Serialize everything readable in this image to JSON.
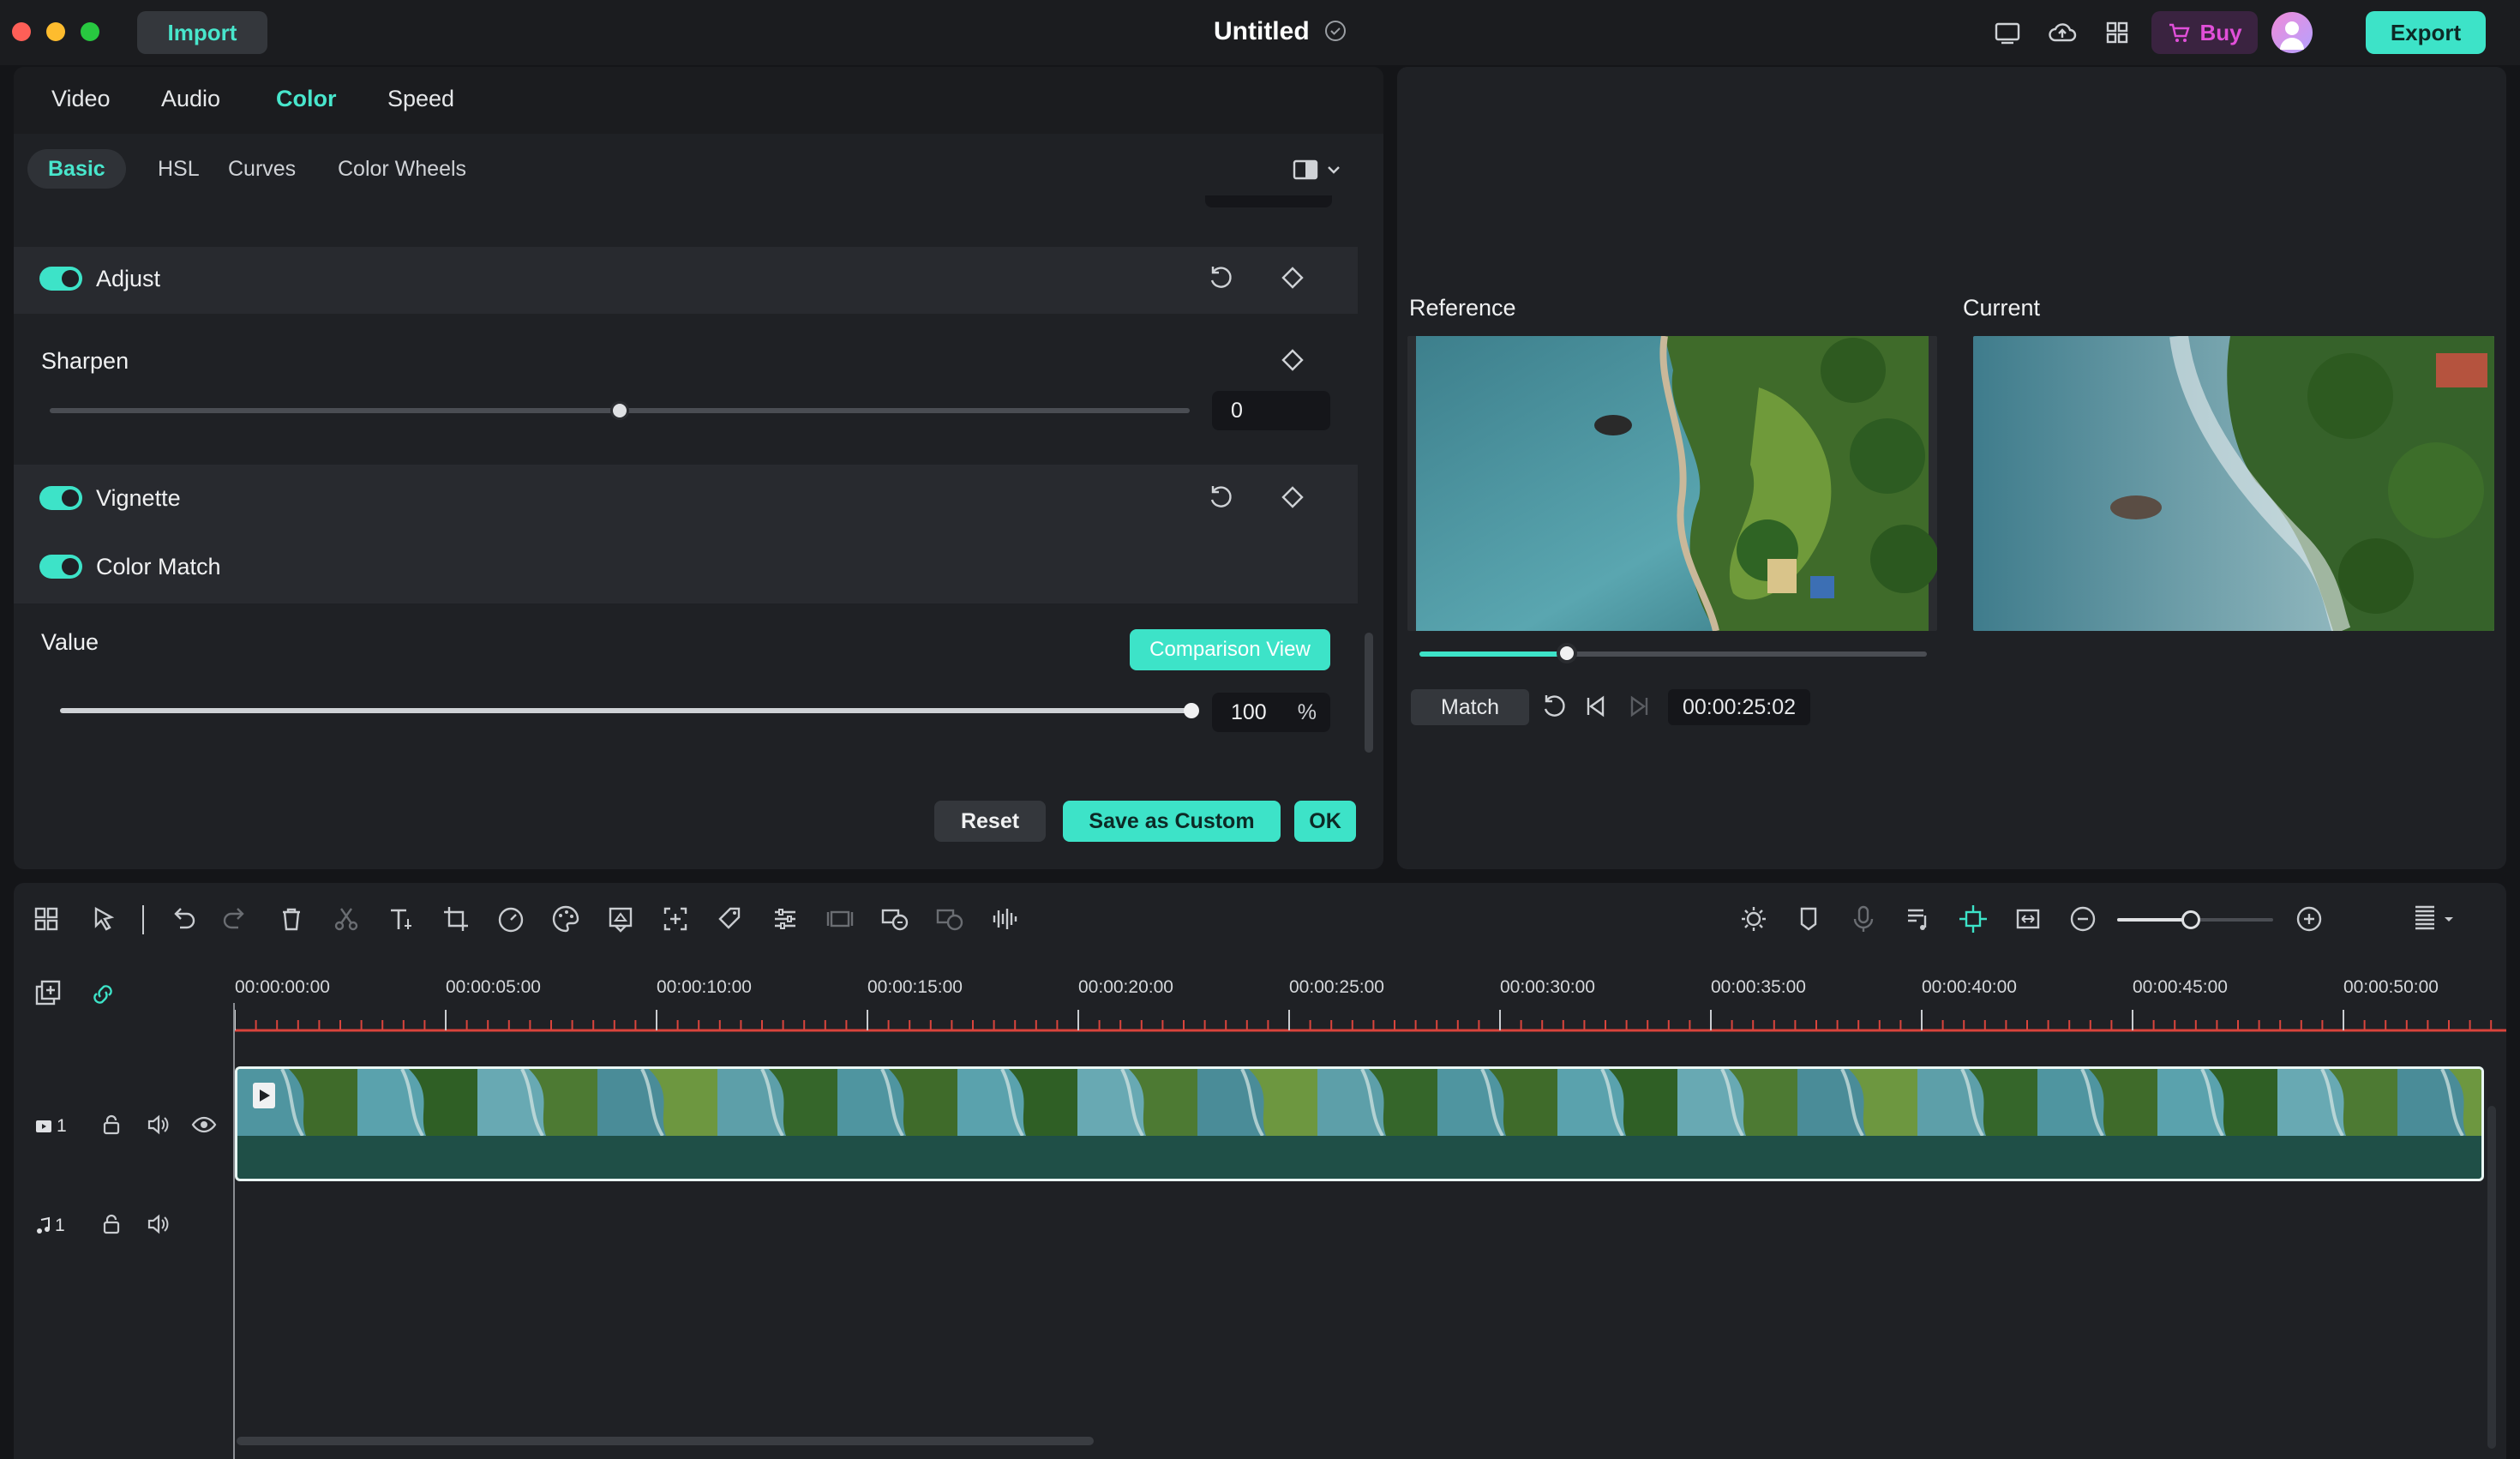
{
  "window": {
    "title": "Untitled",
    "import_label": "Import",
    "buy_label": "Buy",
    "export_label": "Export"
  },
  "left_panel": {
    "tabs": [
      {
        "label": "Video",
        "active": false
      },
      {
        "label": "Audio",
        "active": false
      },
      {
        "label": "Color",
        "active": true
      },
      {
        "label": "Speed",
        "active": false
      }
    ],
    "sub_tabs": [
      {
        "label": "Basic",
        "active": true
      },
      {
        "label": "HSL",
        "active": false
      },
      {
        "label": "Curves",
        "active": false
      },
      {
        "label": "Color Wheels",
        "active": false
      }
    ],
    "adjust": {
      "label": "Adjust",
      "enabled": true
    },
    "sharpen": {
      "label": "Sharpen",
      "value": "0",
      "slider_fraction": 0.5
    },
    "vignette": {
      "label": "Vignette",
      "enabled": true
    },
    "color_match": {
      "label": "Color Match",
      "enabled": true
    },
    "value": {
      "label": "Value",
      "value": "100",
      "unit": "%",
      "slider_fraction": 1.0
    },
    "comparison_view_label": "Comparison View",
    "reset_label": "Reset",
    "save_custom_label": "Save as Custom",
    "ok_label": "OK"
  },
  "preview": {
    "reference_label": "Reference",
    "current_label": "Current",
    "match_label": "Match",
    "timecode": "00:00:25:02",
    "scrub_fraction": 0.29
  },
  "timeline": {
    "ruler_labels": [
      "00:00:00:00",
      "00:00:05:00",
      "00:00:10:00",
      "00:00:15:00",
      "00:00:20:00",
      "00:00:25:00",
      "00:00:30:00",
      "00:00:35:00",
      "00:00:40:00",
      "00:00:45:00",
      "00:00:50:00"
    ],
    "video_track_label": "1",
    "audio_track_label": "1",
    "zoom_fraction": 0.47
  },
  "colors": {
    "accent": "#3de3c8",
    "accent_text": "#48e6cc",
    "buy": "#e14fd9",
    "panel": "#1f2125",
    "playhead_ruler": "#d9443c"
  }
}
